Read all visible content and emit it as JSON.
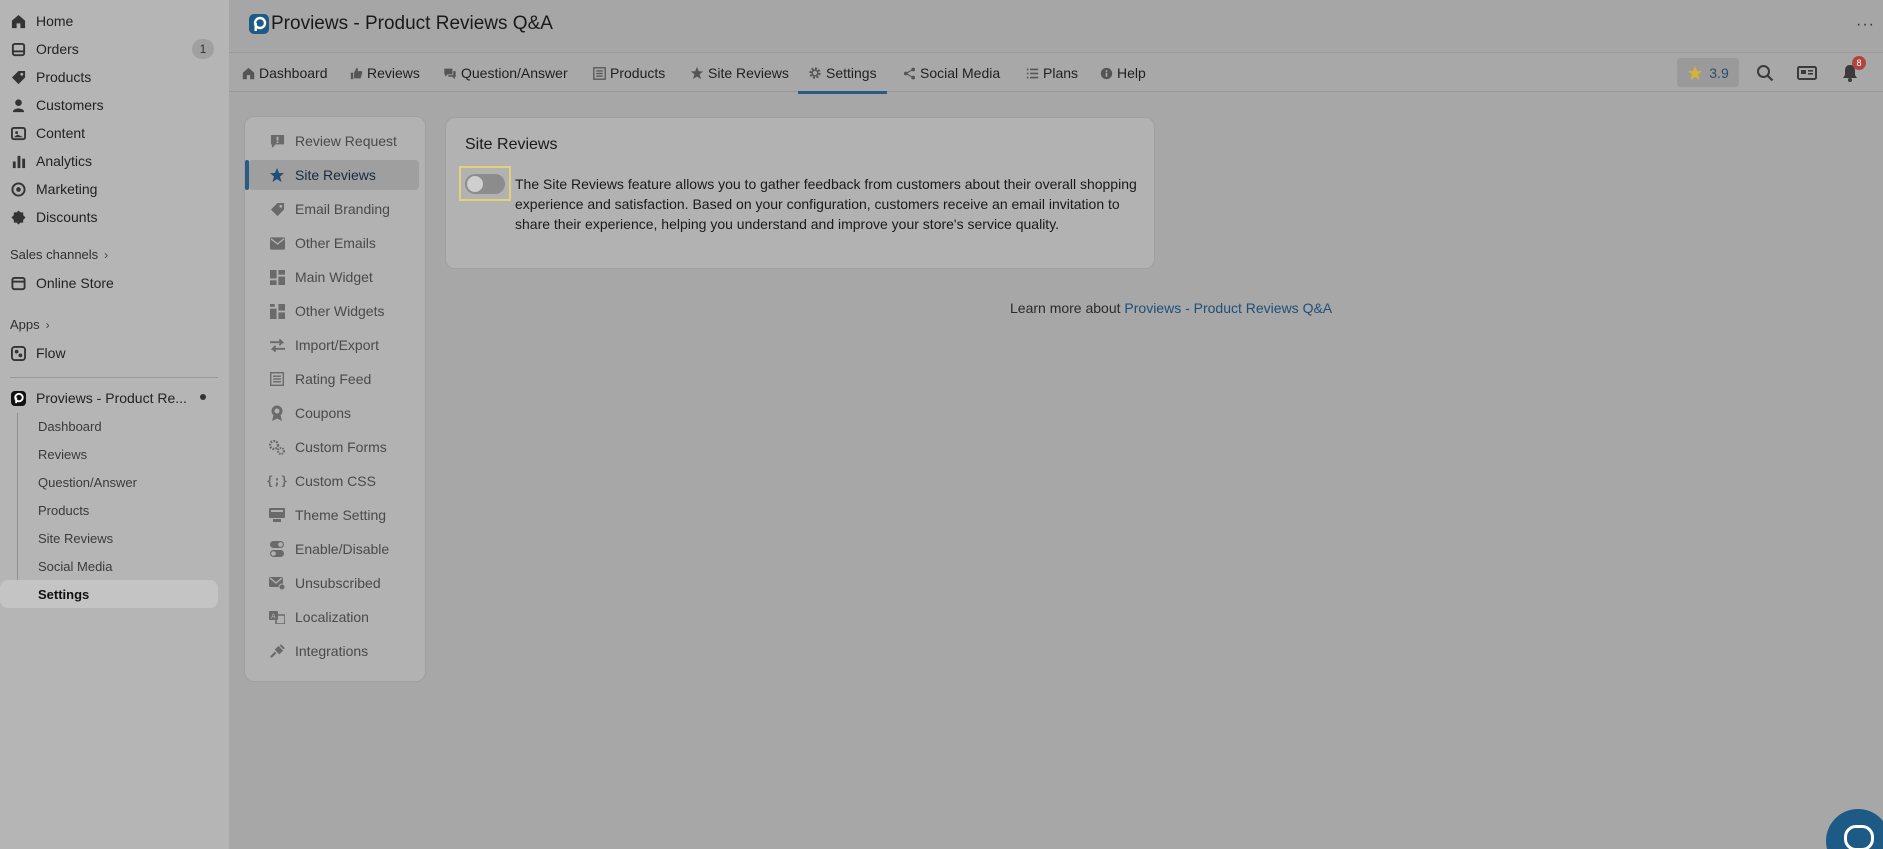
{
  "nav": {
    "items": [
      {
        "label": "Home",
        "icon": "home-icon"
      },
      {
        "label": "Orders",
        "icon": "orders-icon",
        "badge": "1"
      },
      {
        "label": "Products",
        "icon": "tag-icon"
      },
      {
        "label": "Customers",
        "icon": "person-icon"
      },
      {
        "label": "Content",
        "icon": "content-icon"
      },
      {
        "label": "Analytics",
        "icon": "bar-chart-icon"
      },
      {
        "label": "Marketing",
        "icon": "target-icon"
      },
      {
        "label": "Discounts",
        "icon": "discount-icon"
      }
    ],
    "sales_channels": "Sales channels",
    "online_store": "Online Store",
    "apps": "Apps",
    "flow": "Flow",
    "app_name": "Proviews - Product Re...",
    "sub_items": [
      "Dashboard",
      "Reviews",
      "Question/Answer",
      "Products",
      "Site Reviews",
      "Social Media",
      "Settings"
    ]
  },
  "header": {
    "title": "Proviews - Product Reviews Q&A",
    "more": "···"
  },
  "tabs": [
    {
      "label": "Dashboard",
      "icon": "home-icon"
    },
    {
      "label": "Reviews",
      "icon": "thumbs-up-icon"
    },
    {
      "label": "Question/Answer",
      "icon": "chat-icon"
    },
    {
      "label": "Products",
      "icon": "list-icon"
    },
    {
      "label": "Site Reviews",
      "icon": "star-icon"
    },
    {
      "label": "Settings",
      "icon": "gear-icon"
    },
    {
      "label": "Social Media",
      "icon": "share-icon"
    },
    {
      "label": "Plans",
      "icon": "list-icon"
    },
    {
      "label": "Help",
      "icon": "info-icon"
    }
  ],
  "toolbar": {
    "rating": "3.9",
    "notification_count": "8"
  },
  "settings_menu": [
    {
      "label": "Review Request",
      "icon": "review-request-icon"
    },
    {
      "label": "Site Reviews",
      "icon": "star-icon"
    },
    {
      "label": "Email Branding",
      "icon": "tag-icon"
    },
    {
      "label": "Other Emails",
      "icon": "envelope-icon"
    },
    {
      "label": "Main Widget",
      "icon": "widget-icon"
    },
    {
      "label": "Other Widgets",
      "icon": "widgets-icon"
    },
    {
      "label": "Import/Export",
      "icon": "import-export-icon"
    },
    {
      "label": "Rating Feed",
      "icon": "feed-icon"
    },
    {
      "label": "Coupons",
      "icon": "coupon-icon"
    },
    {
      "label": "Custom Forms",
      "icon": "forms-icon"
    },
    {
      "label": "Custom CSS",
      "icon": "css-icon"
    },
    {
      "label": "Theme Setting",
      "icon": "theme-icon"
    },
    {
      "label": "Enable/Disable",
      "icon": "toggle-icon"
    },
    {
      "label": "Unsubscribed",
      "icon": "unsubscribe-icon"
    },
    {
      "label": "Localization",
      "icon": "language-icon"
    },
    {
      "label": "Integrations",
      "icon": "plug-icon"
    }
  ],
  "card": {
    "title": "Site Reviews",
    "toggle_on": false,
    "description": "The Site Reviews feature allows you to gather feedback from customers about their overall shopping experience and satisfaction. Based on your configuration, customers receive an email invitation to share their experience, helping you understand and improve your store's service quality."
  },
  "learn_more": {
    "prefix": "Learn more about ",
    "link": "Proviews - Product Reviews Q&A"
  },
  "colors": {
    "accent": "#2a5a86",
    "badge": "#b0453d",
    "highlight": "#e3d07a"
  }
}
